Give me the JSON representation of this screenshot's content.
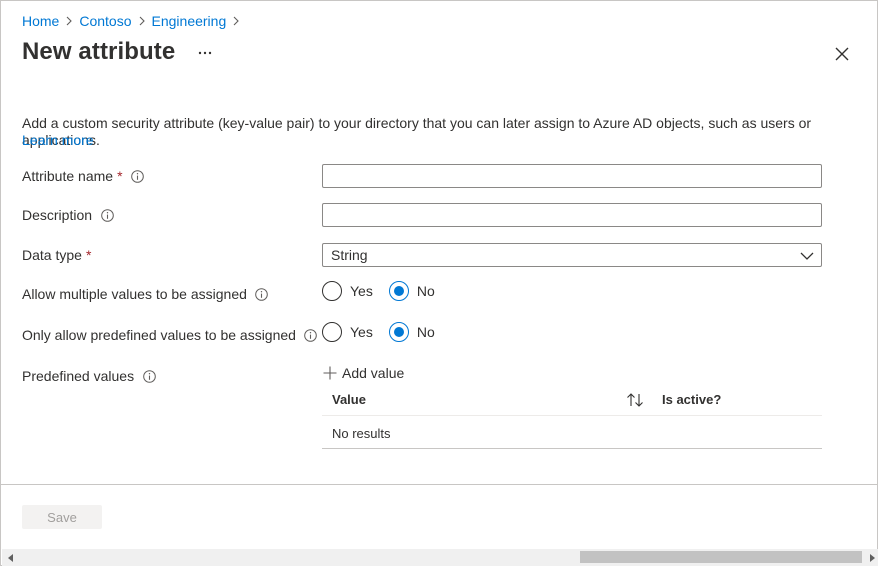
{
  "breadcrumb": {
    "items": [
      "Home",
      "Contoso",
      "Engineering"
    ]
  },
  "header": {
    "title": "New attribute",
    "more_label": "···"
  },
  "intro": {
    "text": "Add a custom security attribute (key-value pair) to your directory that you can later assign to Azure AD objects, such as users or applications.",
    "learn_more": "Learn more"
  },
  "form": {
    "attribute_name": {
      "label": "Attribute name",
      "required": "*",
      "value": ""
    },
    "description": {
      "label": "Description",
      "value": ""
    },
    "data_type": {
      "label": "Data type",
      "required": "*",
      "selected": "String"
    },
    "allow_multiple": {
      "label": "Allow multiple values to be assigned",
      "options": [
        "Yes",
        "No"
      ],
      "selected": "No"
    },
    "predefined_only": {
      "label": "Only allow predefined values to be assigned",
      "options": [
        "Yes",
        "No"
      ],
      "selected": "No"
    },
    "predefined_values": {
      "label": "Predefined values",
      "add_label": "Add value",
      "columns": [
        "Value",
        "Is active?"
      ],
      "empty_text": "No results"
    }
  },
  "footer": {
    "save_label": "Save"
  },
  "colors": {
    "accent": "#0078d4",
    "required": "#a4262c",
    "disabled_bg": "#f3f2f1",
    "disabled_text": "#a19f9d"
  },
  "icons": [
    "chevron-right-icon",
    "more-icon",
    "close-icon",
    "info-icon",
    "chevron-down-icon",
    "plus-icon",
    "sort-icon",
    "scroll-left-icon",
    "scroll-right-icon"
  ]
}
